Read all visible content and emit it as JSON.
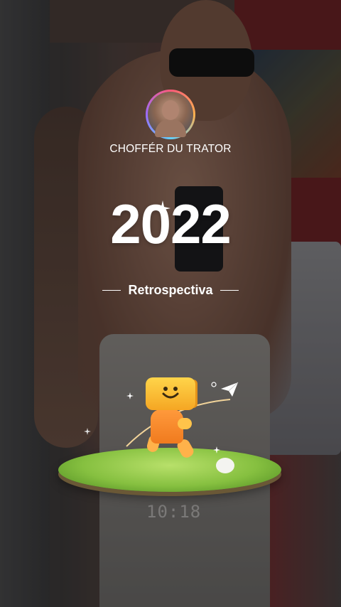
{
  "story": {
    "username": "CHOFFÉR DU TRATOR",
    "year": "2022",
    "subtitle": "Retrospectiva",
    "background_time": "10:18"
  },
  "icons": {
    "avatar": "profile-avatar",
    "sparkle": "sparkle-icon",
    "paper_plane": "paper-plane-icon",
    "mascot": "box-mascot-icon"
  },
  "colors": {
    "text": "#ffffff",
    "grass": "#86c040",
    "mascot": "#f5a623"
  }
}
